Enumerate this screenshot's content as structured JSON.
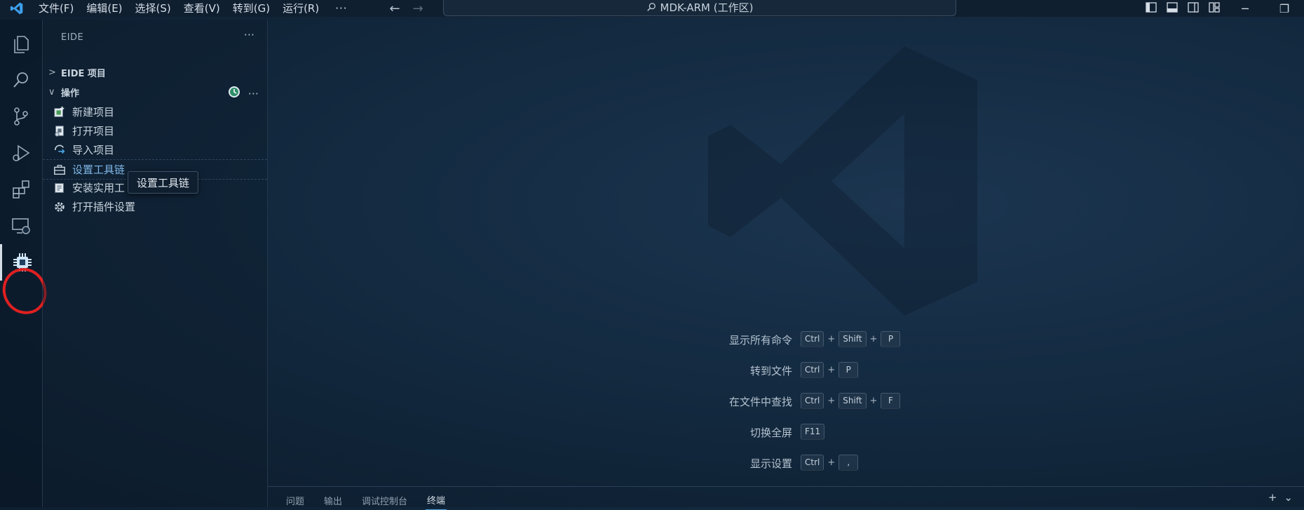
{
  "titlebar": {
    "menus": [
      "文件(F)",
      "编辑(E)",
      "选择(S)",
      "查看(V)",
      "转到(G)",
      "运行(R)"
    ],
    "more": "···",
    "search_text": "MDK-ARM (工作区)"
  },
  "sidebar": {
    "header": "EIDE",
    "header_more": "···",
    "sections": {
      "project": {
        "label": "EIDE 项目",
        "chevron": ">"
      },
      "actions": {
        "label": "操作",
        "chevron": "∨",
        "more": "···"
      }
    },
    "items": [
      {
        "label": "新建项目",
        "icon": "new-project-icon"
      },
      {
        "label": "打开项目",
        "icon": "open-project-icon"
      },
      {
        "label": "导入项目",
        "icon": "import-project-icon"
      },
      {
        "label": "设置工具链",
        "icon": "toolbox-icon"
      },
      {
        "label": "安装实用工",
        "icon": "install-tools-icon"
      },
      {
        "label": "打开插件设置",
        "icon": "gear-icon"
      }
    ],
    "tooltip": "设置工具链"
  },
  "editor": {
    "shortcuts": [
      {
        "label": "显示所有命令",
        "keys": [
          "Ctrl",
          "Shift",
          "P"
        ]
      },
      {
        "label": "转到文件",
        "keys": [
          "Ctrl",
          "P"
        ]
      },
      {
        "label": "在文件中查找",
        "keys": [
          "Ctrl",
          "Shift",
          "F"
        ]
      },
      {
        "label": "切换全屏",
        "keys": [
          "F11"
        ]
      },
      {
        "label": "显示设置",
        "keys": [
          "Ctrl",
          ","
        ]
      }
    ],
    "plus": "+"
  },
  "panel": {
    "tabs": [
      "问题",
      "输出",
      "调试控制台",
      "终端"
    ],
    "active_tab": "终端",
    "add": "+",
    "dropdown": "⌄"
  },
  "colors": {
    "accent": "#4aa3e0",
    "annotation": "#e02020",
    "vscode_blue": "#3ea0ea"
  }
}
